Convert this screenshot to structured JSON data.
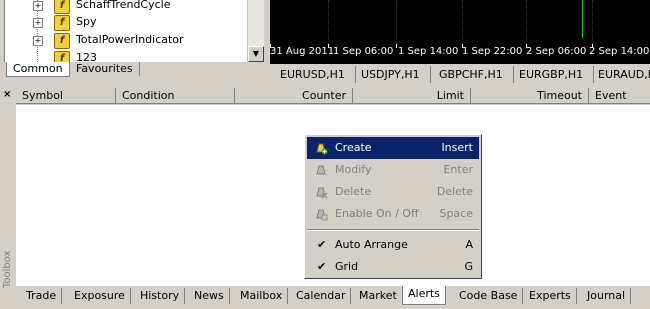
{
  "navigator": {
    "items": [
      {
        "label": "SchaffTrendCycle"
      },
      {
        "label": "Spy"
      },
      {
        "label": "TotalPowerIndicator"
      },
      {
        "label": "123"
      }
    ],
    "tabs": [
      {
        "label": "Common"
      },
      {
        "label": "Favourites"
      }
    ],
    "active_tab": "Common"
  },
  "chart": {
    "time_labels": [
      "31 Aug 2011",
      "1 Sep 06:00",
      "1 Sep 14:00",
      "1 Sep 22:00",
      "2 Sep 06:00",
      "2 Sep 14:00"
    ],
    "tabs": [
      {
        "label": "EURUSD,H1"
      },
      {
        "label": "USDJPY,H1"
      },
      {
        "label": "GBPCHF,H1"
      },
      {
        "label": "EURGBP,H1"
      },
      {
        "label": "EURAUD,H"
      }
    ]
  },
  "toolbox": {
    "title": "Toolbox",
    "close_glyph": "×",
    "columns": [
      "Symbol",
      "Condition",
      "Counter",
      "Limit",
      "Timeout",
      "Event"
    ],
    "tabs": [
      "Trade",
      "Exposure",
      "History",
      "News",
      "Mailbox",
      "Calendar",
      "Market",
      "Alerts",
      "Code Base",
      "Experts",
      "Journal"
    ],
    "active_tab": "Alerts"
  },
  "context_menu": {
    "items": [
      {
        "label": "Create",
        "shortcut": "Insert",
        "icon": "alert-create-icon",
        "state": "highlighted"
      },
      {
        "label": "Modify",
        "shortcut": "Enter",
        "icon": "alert-modify-icon",
        "state": "disabled"
      },
      {
        "label": "Delete",
        "shortcut": "Delete",
        "icon": "alert-delete-icon",
        "state": "disabled"
      },
      {
        "label": "Enable On / Off",
        "shortcut": "Space",
        "icon": "alert-toggle-icon",
        "state": "disabled"
      },
      {
        "label": "Auto Arrange",
        "shortcut": "A",
        "icon": "check-icon",
        "state": "checked"
      },
      {
        "label": "Grid",
        "shortcut": "G",
        "icon": "check-icon",
        "state": "checked"
      }
    ]
  },
  "colors": {
    "menu_highlight": "#0a246a",
    "chart_bg": "#000000",
    "chart_candle": "#00d000",
    "indicator_icon": "#f0d040"
  }
}
